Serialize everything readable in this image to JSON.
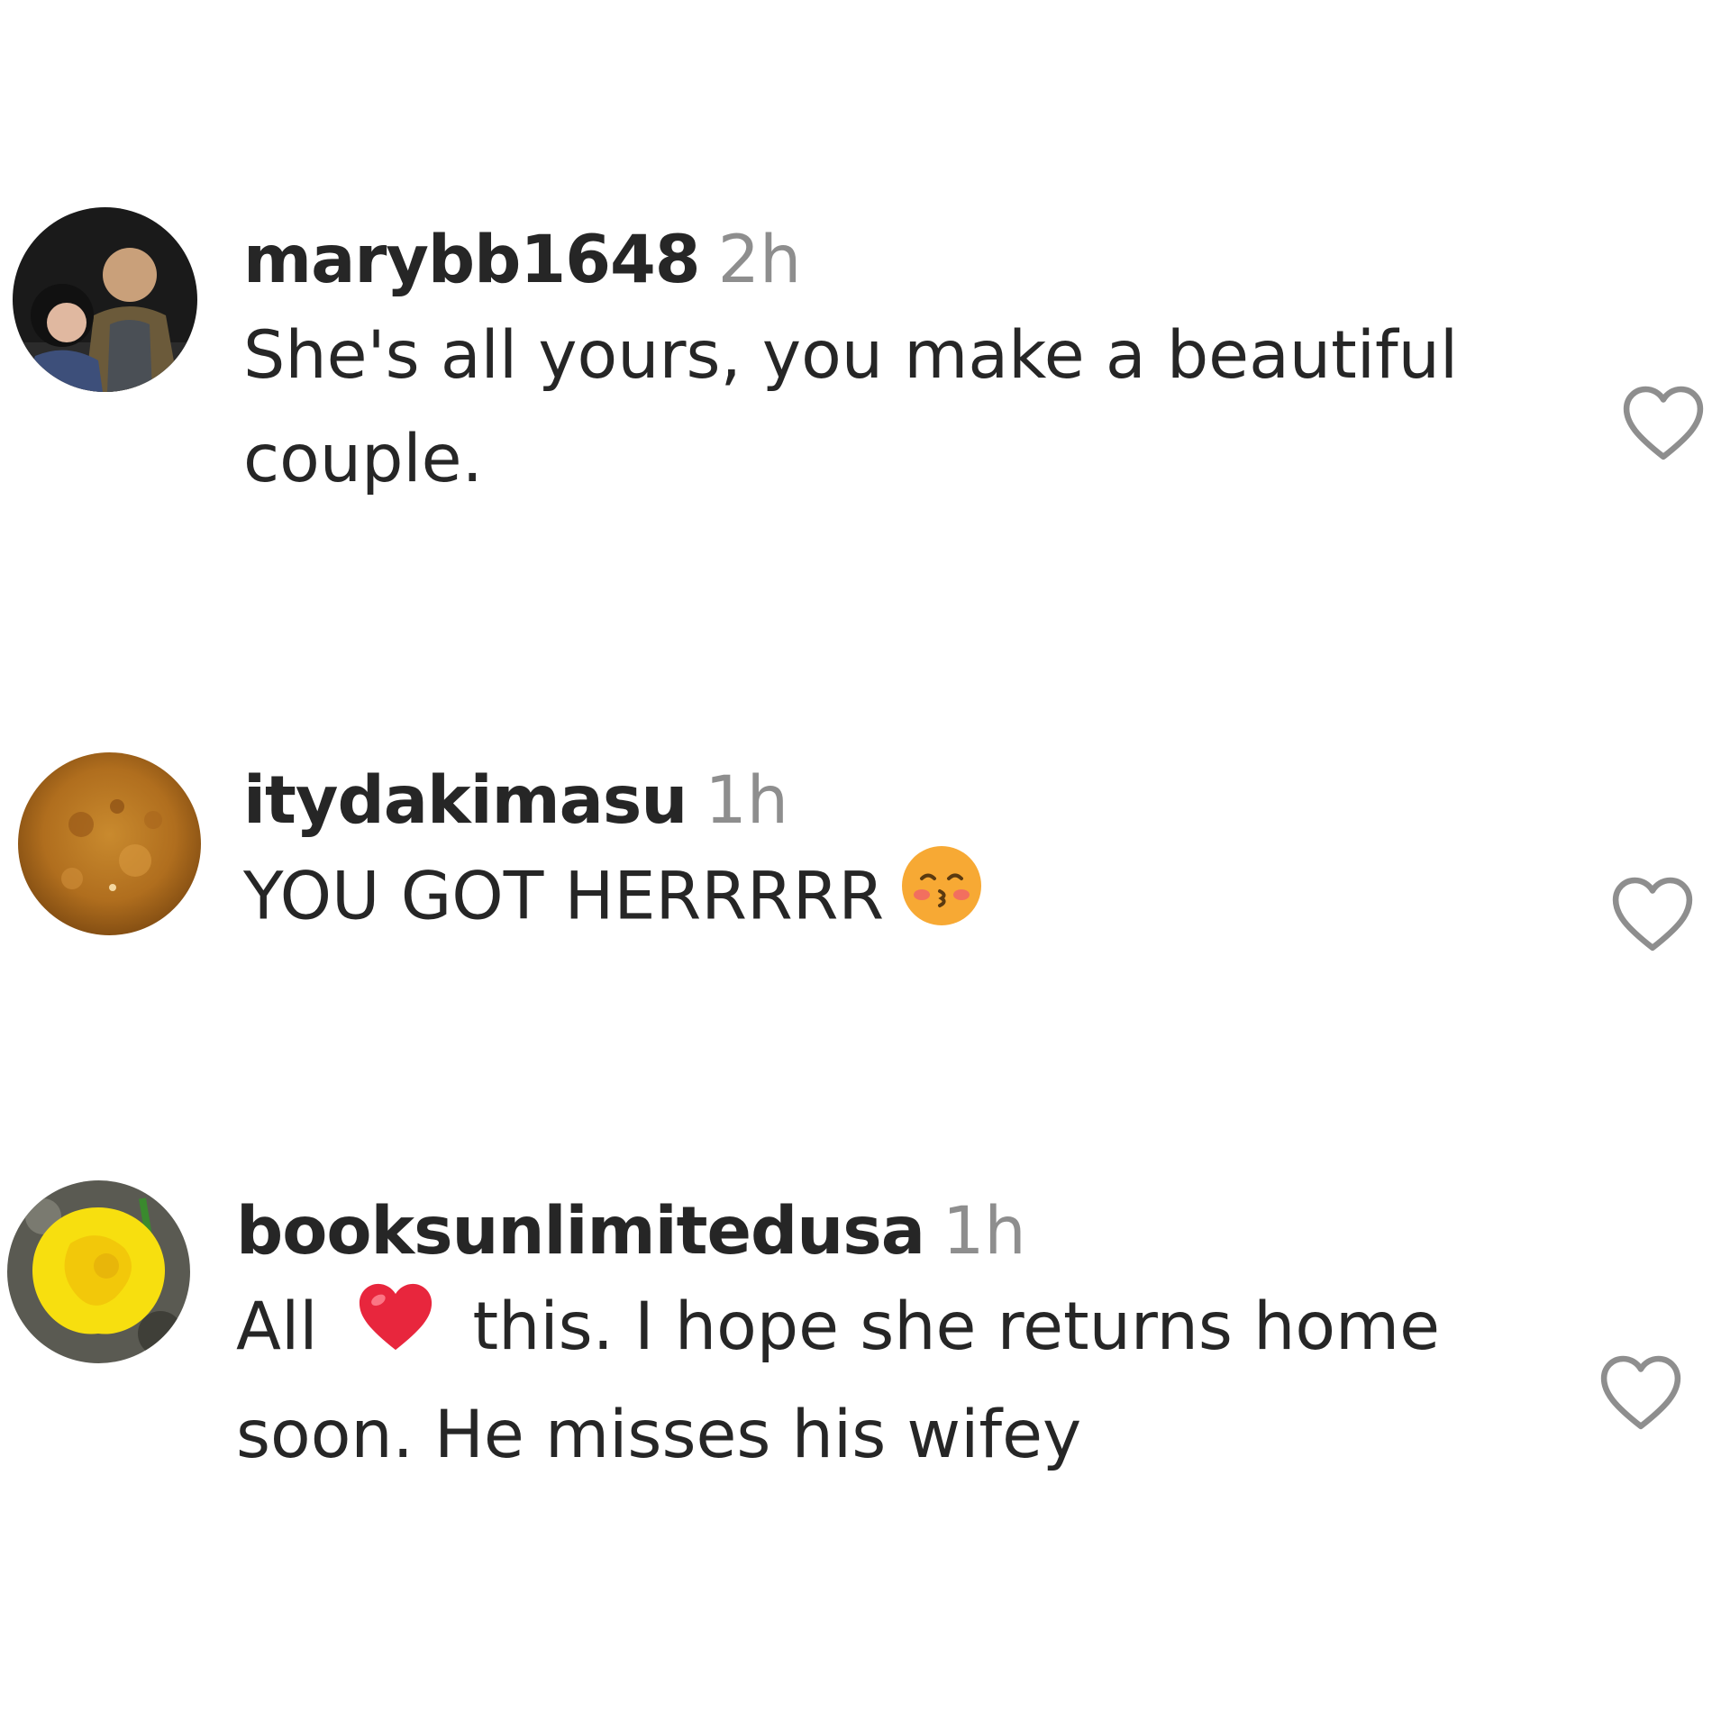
{
  "comments": [
    {
      "username": "marybb1648",
      "time": "2h",
      "text_parts": [
        "She's all yours, you make a beautiful couple."
      ]
    },
    {
      "username": "itydakimasu",
      "time": "1h",
      "text_parts": [
        "YOU GOT HERRRRR",
        ""
      ]
    },
    {
      "username": "booksunlimitedusa",
      "time": "1h",
      "text_parts": [
        "All",
        "this. I hope she returns home soon. He misses his wifey"
      ]
    }
  ],
  "icons": {
    "like": "heart-outline-icon",
    "emoji_2": "kissing-face-closed-eyes-emoji",
    "emoji_3": "red-heart-emoji"
  },
  "colors": {
    "text": "#262626",
    "muted": "#8e8e8e",
    "heart_outline": "#8e8e8e",
    "red_heart": "#e8263d"
  }
}
